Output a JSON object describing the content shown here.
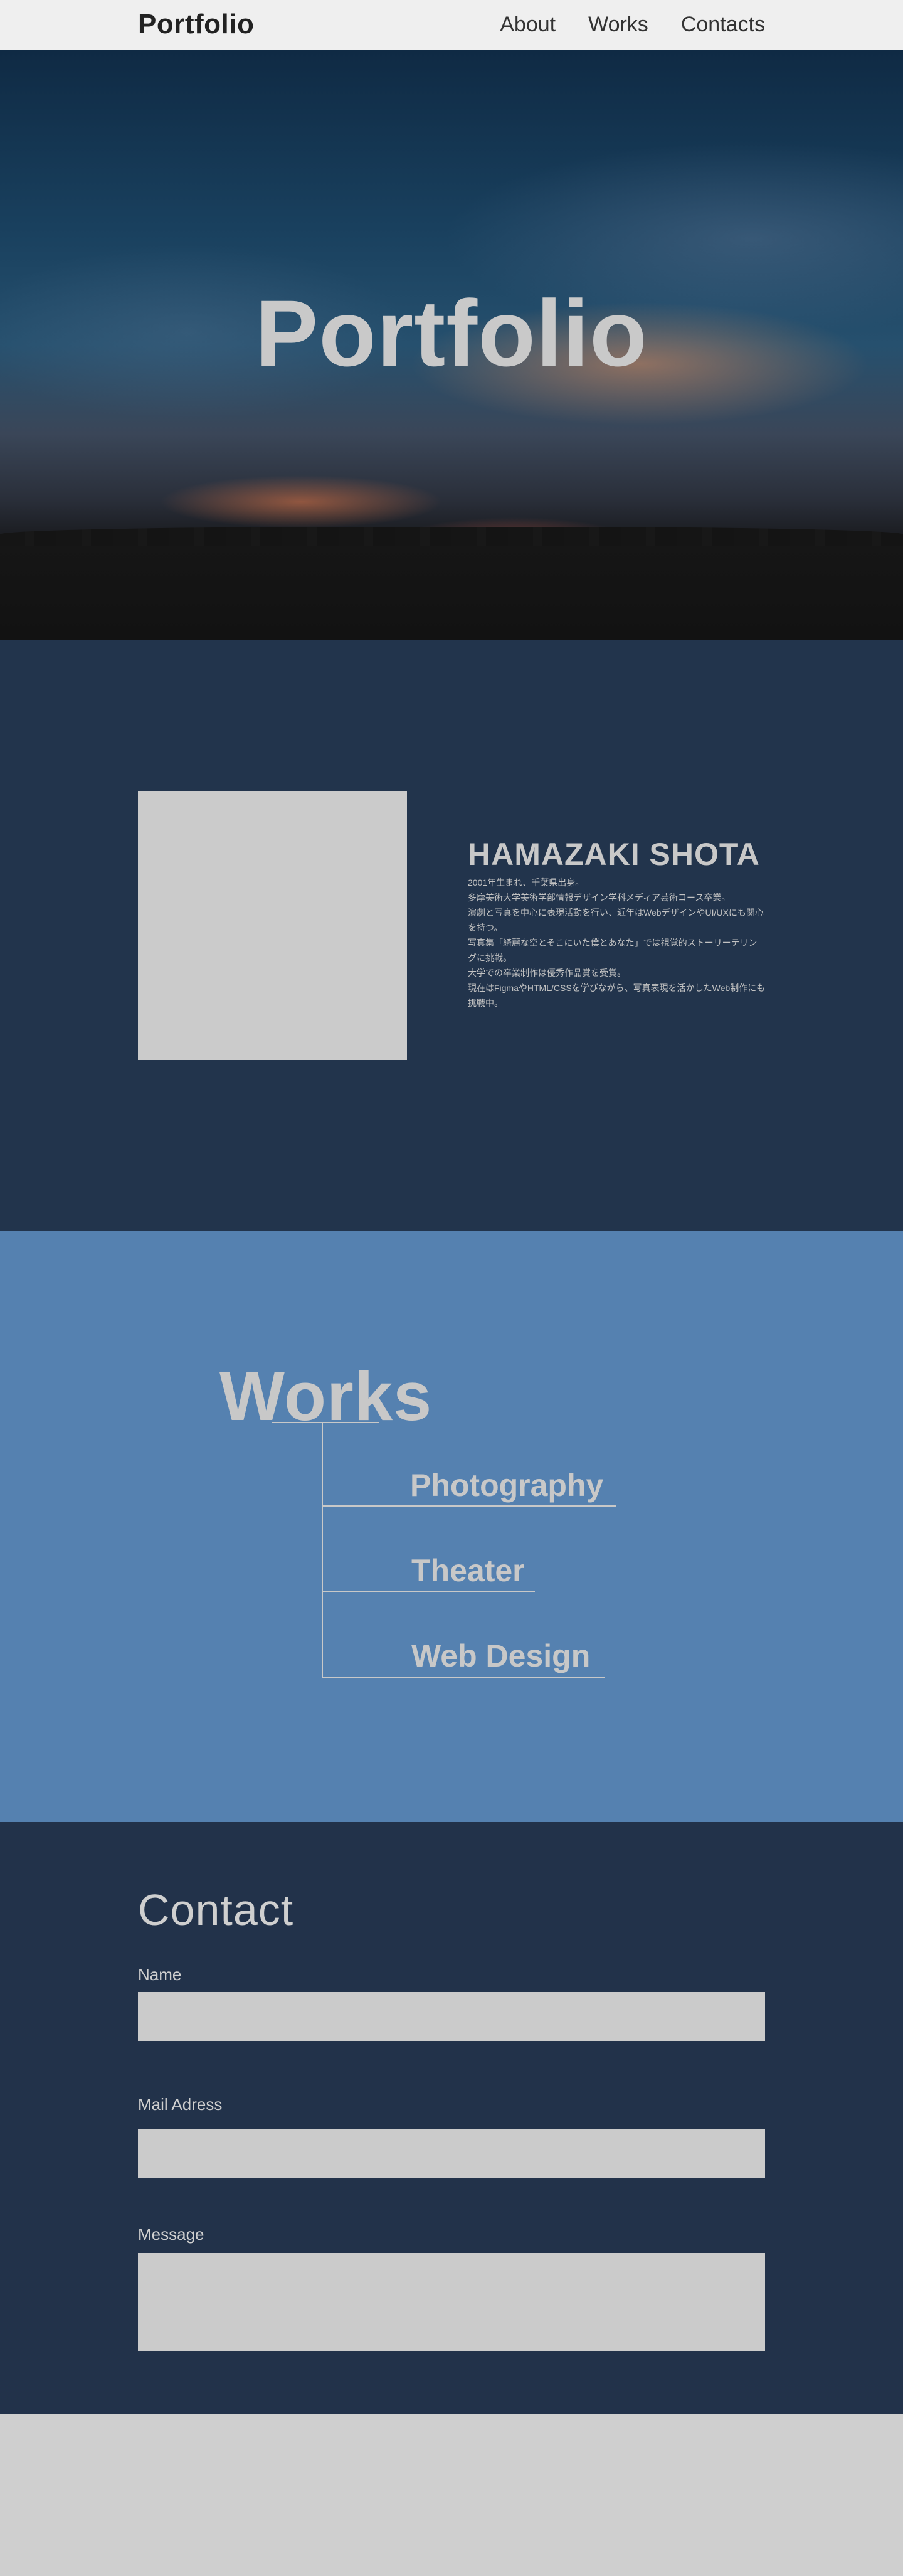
{
  "header": {
    "logo": "Portfolio",
    "nav": [
      "About",
      "Works",
      "Contacts"
    ]
  },
  "hero": {
    "title": "Portfolio"
  },
  "about": {
    "name": "HAMAZAKI SHOTA",
    "bio": [
      "2001年生まれ、千葉県出身。",
      "多摩美術大学美術学部情報デザイン学科メディア芸術コース卒業。",
      "演劇と写真を中心に表現活動を行い、近年はWebデザインやUI/UXにも関心",
      "を持つ。",
      "写真集「綺麗な空とそこにいた僕とあなた」では視覚的ストーリーテリン",
      "グに挑戦。",
      "大学での卒業制作は優秀作品賞を受賞。",
      "現在はFigmaやHTML/CSSを学びながら、写真表現を活かしたWeb制作にも",
      "挑戦中。"
    ]
  },
  "works": {
    "title": "Works",
    "items": [
      "Photography",
      "Theater",
      "Web Design"
    ]
  },
  "contact": {
    "title": "Contact",
    "fields": {
      "name_label": "Name",
      "mail_label": "Mail Adress",
      "message_label": "Message",
      "name_value": "",
      "mail_value": "",
      "message_value": ""
    }
  },
  "colors": {
    "header_bg": "#efefef",
    "about_bg": "#22344c",
    "works_bg": "#5581b0",
    "contact_bg": "#22324a",
    "light_gray": "#cbcbcb"
  }
}
